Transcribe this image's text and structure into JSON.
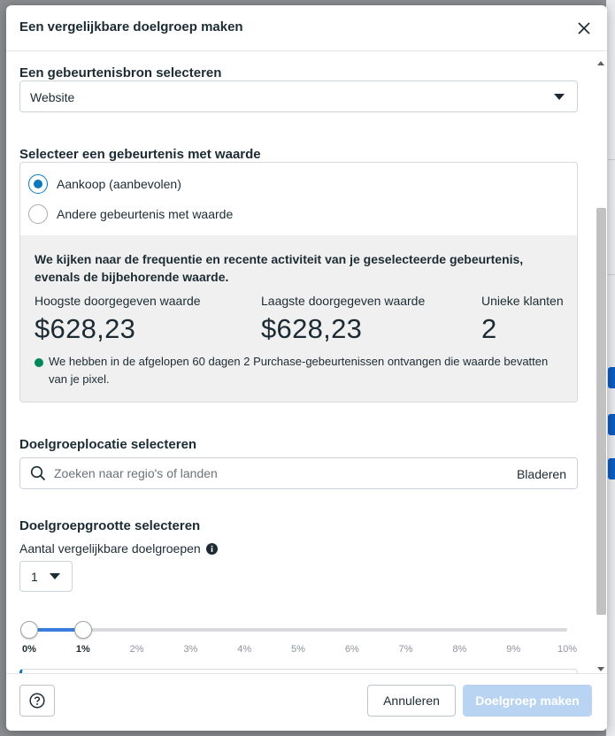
{
  "dialog": {
    "title": "Een vergelijkbare doelgroep maken"
  },
  "event_source": {
    "label": "Een gebeurtenisbron selecteren",
    "value": "Website"
  },
  "value_event": {
    "label": "Selecteer een gebeurtenis met waarde",
    "options": [
      {
        "label": "Aankoop (aanbevolen)",
        "selected": true
      },
      {
        "label": "Andere gebeurtenis met waarde",
        "selected": false
      }
    ],
    "info_text": "We kijken naar de frequentie en recente activiteit van je geselecteerde gebeurtenis, evenals de bijbehorende waarde.",
    "stats": [
      {
        "label": "Hoogste doorgegeven waarde",
        "value": "$628,23"
      },
      {
        "label": "Laagste doorgegeven waarde",
        "value": "$628,23"
      },
      {
        "label": "Unieke klanten",
        "value": "2"
      }
    ],
    "note": "We hebben in de afgelopen 60 dagen 2 Purchase-gebeurtenissen ontvangen die waarde bevatten van je pixel.",
    "note_color": "#00875a"
  },
  "location": {
    "label": "Doelgroeplocatie selecteren",
    "placeholder": "Zoeken naar regio's of landen",
    "browse_label": "Bladeren"
  },
  "size": {
    "label": "Doelgroepgrootte selecteren",
    "count_label": "Aantal vergelijkbare doelgroepen",
    "count_value": "1",
    "range_start": 0,
    "range_end": 1,
    "ticks": [
      "0%",
      "1%",
      "2%",
      "3%",
      "4%",
      "5%",
      "6%",
      "7%",
      "8%",
      "9%",
      "10%"
    ]
  },
  "footer": {
    "cancel_label": "Annuleren",
    "create_label": "Doelgroep maken"
  },
  "colors": {
    "accent": "#0a78be",
    "slider_fill": "#3b7ddd",
    "primary_disabled": "#b9d4f2"
  }
}
